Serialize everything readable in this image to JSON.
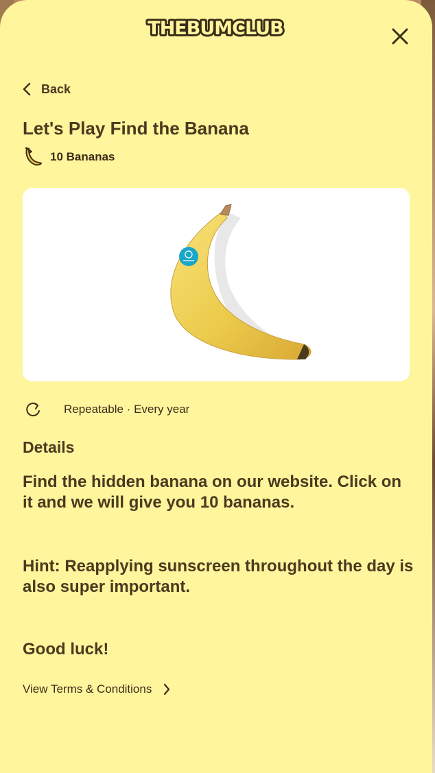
{
  "header": {
    "logo_text": "THE BUM CLUB",
    "close_icon": "close-icon"
  },
  "nav": {
    "back_label": "Back",
    "back_icon": "chevron-left-icon"
  },
  "reward": {
    "title": "Let's Play Find the Banana",
    "amount_label": "10 Bananas",
    "icon": "banana-icon"
  },
  "media": {
    "image": "banana-image",
    "sticker_icon": "brand-sticker-icon"
  },
  "frequency": {
    "label": "Repeatable · Every year",
    "icon": "refresh-icon"
  },
  "details": {
    "heading": "Details",
    "paragraph_1": "Find the hidden banana on our website. Click on it and we will give you 10 bananas.",
    "paragraph_2": "Hint: Reapplying sunscreen throughout the day is also super important.",
    "paragraph_3": "Good luck!"
  },
  "terms": {
    "label": "View Terms & Conditions",
    "icon": "chevron-right-icon"
  },
  "colors": {
    "panel_bg": "#fff59d",
    "text": "#4a3a1e",
    "banana": "#f5d04a"
  }
}
